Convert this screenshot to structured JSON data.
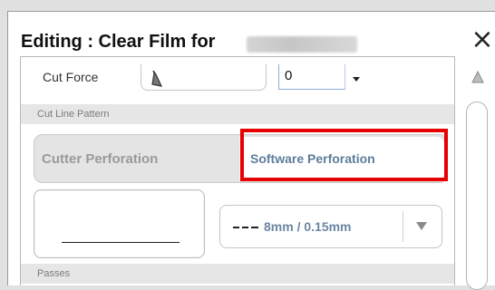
{
  "dialog": {
    "title": "Editing : Clear Film for",
    "close_symbol": "×"
  },
  "cut_force": {
    "label": "Cut Force",
    "value": "0",
    "slider_thumb_icon": "slider-thumb-icon",
    "dropdown_icon": "dropdown-arrow-icon"
  },
  "cut_line_pattern": {
    "section_label": "Cut Line Pattern",
    "options": [
      "Cutter Perforation",
      "Software Perforation"
    ],
    "selected": "Software Perforation",
    "pattern_value": "8mm / 0.15mm",
    "dash_icon": "dashed-line-icon",
    "dropdown_icon": "dropdown-arrow-icon"
  },
  "passes": {
    "section_label": "Passes"
  },
  "colors": {
    "highlight": "#e60000",
    "selected_text": "#5d7d9b",
    "unselected_text": "#9a9a9a"
  }
}
